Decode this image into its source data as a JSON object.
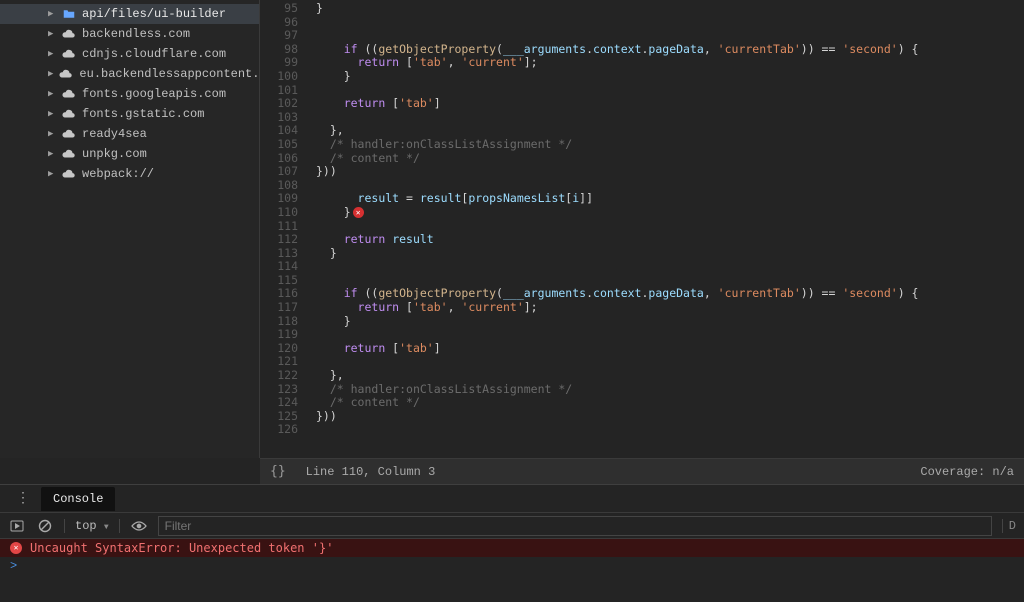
{
  "sidebar": {
    "active": {
      "label": "api/files/ui-builder"
    },
    "items": [
      {
        "label": "backendless.com"
      },
      {
        "label": "cdnjs.cloudflare.com"
      },
      {
        "label": "eu.backendlessappcontent.com"
      },
      {
        "label": "fonts.googleapis.com"
      },
      {
        "label": "fonts.gstatic.com"
      },
      {
        "label": "ready4sea"
      },
      {
        "label": "unpkg.com"
      },
      {
        "label": "webpack://"
      }
    ]
  },
  "editor": {
    "first_line": 95,
    "lines": [
      "}",
      "",
      "",
      "    if ((getObjectProperty(___arguments.context.pageData, 'currentTab')) == 'second') {",
      "      return ['tab', 'current'];",
      "    }",
      "",
      "    return ['tab']",
      "",
      "  },",
      "  /* handler:onClassListAssignment */",
      "  /* content */",
      "}))",
      "",
      "      result = result[propsNamesList[i]]",
      "    }⊗",
      "",
      "    return result",
      "  }",
      "",
      "",
      "    if ((getObjectProperty(___arguments.context.pageData, 'currentTab')) == 'second') {",
      "      return ['tab', 'current'];",
      "    }",
      "",
      "    return ['tab']",
      "",
      "  },",
      "  /* handler:onClassListAssignment */",
      "  /* content */",
      "}))",
      ""
    ]
  },
  "statusbar": {
    "braces": "{}",
    "position": "Line 110, Column 3",
    "coverage": "Coverage: n/a"
  },
  "drawer": {
    "tab": "Console",
    "scope": "top",
    "filter_placeholder": "Filter",
    "trailing": "D",
    "error": "Uncaught SyntaxError: Unexpected token '}'",
    "prompt": ">"
  }
}
